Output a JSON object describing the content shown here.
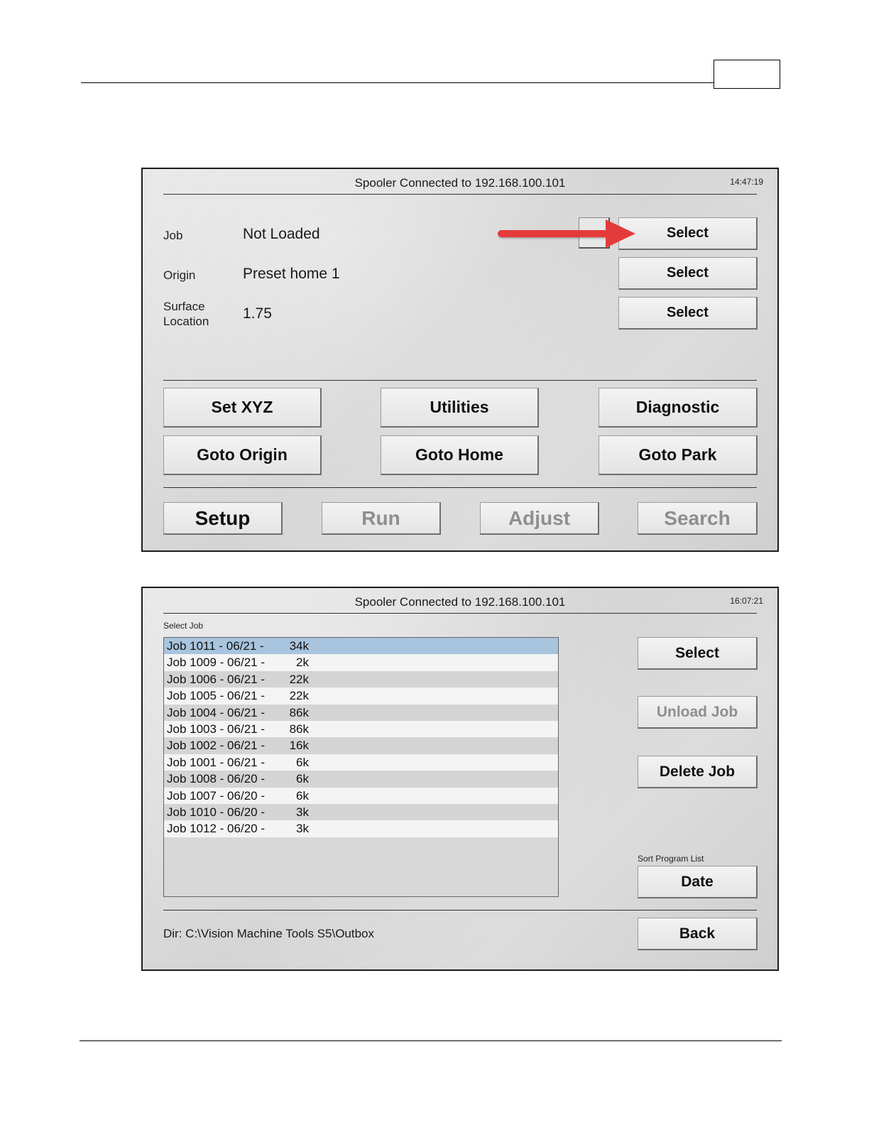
{
  "screen1": {
    "connection_title": "Spooler Connected to 192.168.100.101",
    "clock": "14:47:19",
    "fields": [
      {
        "label": "Job",
        "value": "Not Loaded",
        "button": "Select"
      },
      {
        "label": "Origin",
        "value": "Preset home 1",
        "button": "Select"
      },
      {
        "label": "Surface Location",
        "value": "1.75",
        "button": "Select"
      }
    ],
    "action_buttons": {
      "set_xyz": "Set XYZ",
      "utilities": "Utilities",
      "diagnostic": "Diagnostic",
      "goto_origin": "Goto Origin",
      "goto_home": "Goto Home",
      "goto_park": "Goto Park"
    },
    "mode_tabs": {
      "setup": "Setup",
      "run": "Run",
      "adjust": "Adjust",
      "search": "Search"
    },
    "annotation_color": "#e53a3a"
  },
  "screen2": {
    "connection_title": "Spooler Connected to 192.168.100.101",
    "clock": "16:07:21",
    "list_label": "Select Job",
    "jobs": [
      {
        "name": "Job 1011 - 06/21 -",
        "size": "34k"
      },
      {
        "name": "Job 1009 - 06/21 -",
        "size": "2k"
      },
      {
        "name": "Job 1006 - 06/21 -",
        "size": "22k"
      },
      {
        "name": "Job 1005 - 06/21 -",
        "size": "22k"
      },
      {
        "name": "Job 1004 - 06/21 -",
        "size": "86k"
      },
      {
        "name": "Job 1003 - 06/21 -",
        "size": "86k"
      },
      {
        "name": "Job 1002 - 06/21 -",
        "size": "16k"
      },
      {
        "name": "Job 1001 - 06/21 -",
        "size": "6k"
      },
      {
        "name": "Job 1008 - 06/20 -",
        "size": "6k"
      },
      {
        "name": "Job 1007 - 06/20 -",
        "size": "6k"
      },
      {
        "name": "Job 1010 - 06/20 -",
        "size": "3k"
      },
      {
        "name": "Job 1012 - 06/20 -",
        "size": "3k"
      }
    ],
    "selected_index": 0,
    "buttons": {
      "select": "Select",
      "unload_job": "Unload Job",
      "delete_job": "Delete Job",
      "sort_label": "Sort Program List",
      "sort_value": "Date",
      "back": "Back"
    },
    "directory": "Dir: C:\\Vision Machine Tools S5\\Outbox",
    "selection_color": "#a9c4de"
  }
}
